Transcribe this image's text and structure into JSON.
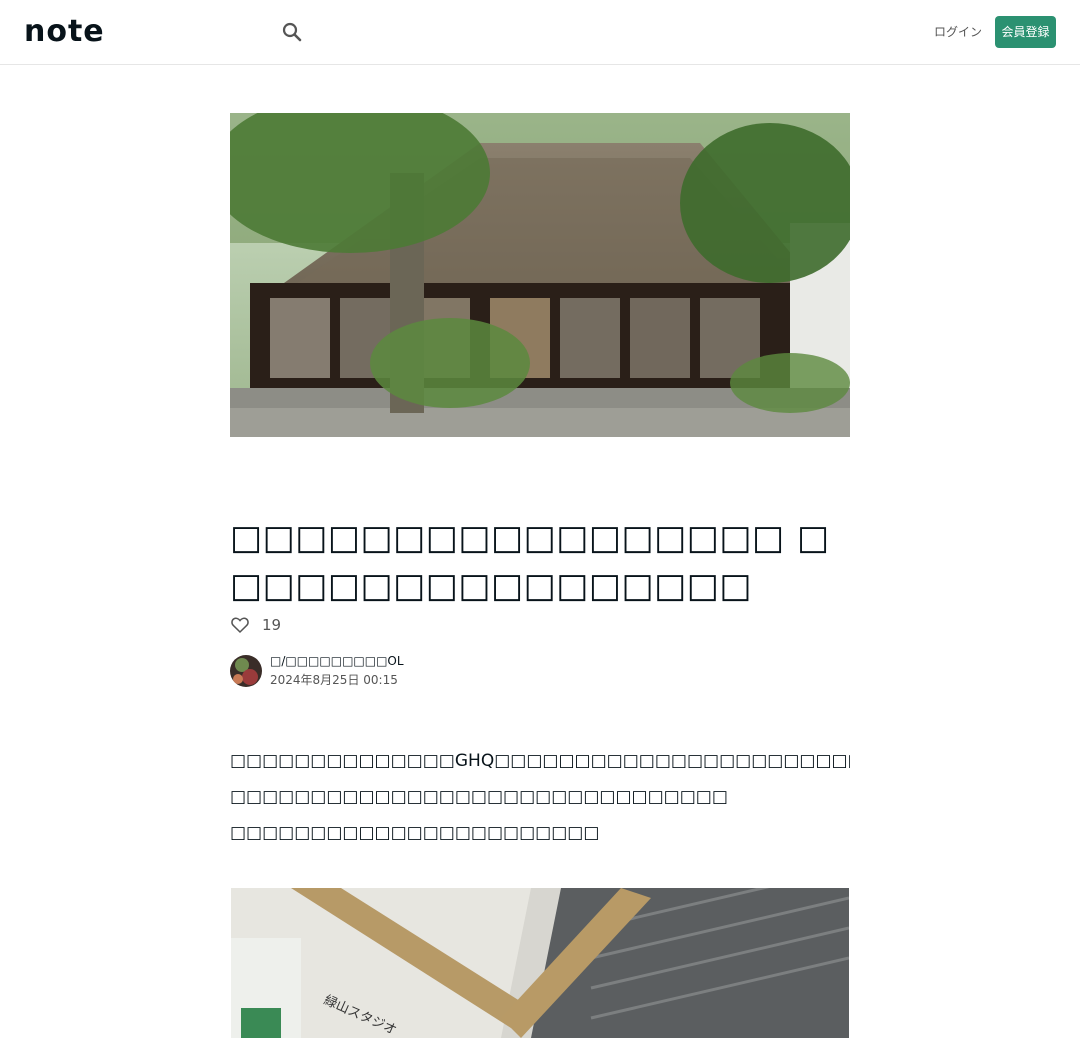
{
  "header": {
    "logo_text": "note",
    "login_label": "ログイン",
    "signup_label": "会員登録"
  },
  "icons": {
    "search": "search-icon",
    "like": "heart-icon"
  },
  "colors": {
    "accent": "#2b9171",
    "text": "#08131a"
  },
  "article": {
    "title": "□□□□□□□□□□□□□□□□□ □□□□□□□□□□□□□□□□□",
    "like_count": "19",
    "author_name": "□/□□□□□□□□□OL",
    "date": "2024年8月25日 00:15",
    "paragraphs": [
      "□□□□□□□□□□□□□□GHQ□□□□□□□□□□□□□□□□□□□□□□□□□□□□□",
      "□□□□□□□□□□□□□□□□□□□□□□□□□□□□□□□",
      "□□□□□□□□□□□□□□□□□□□□□□□"
    ],
    "photo2_sign_text": "緑山スタジオ"
  }
}
